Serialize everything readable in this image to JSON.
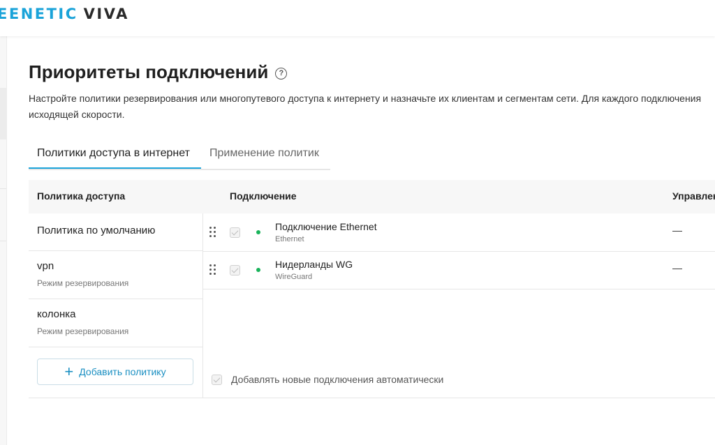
{
  "brand": {
    "part1": "EENETIC",
    "part2": "VIVA"
  },
  "page": {
    "title": "Приоритеты подключений",
    "help_icon": "question-circle-icon",
    "description_line1": "Настройте политики резервирования или многопутевого доступа к интернету и назначьте их клиентам и сегментам сети. Для каждого подключения",
    "description_line2": "исходящей скорости."
  },
  "tabs": [
    {
      "label": "Политики доступа в интернет",
      "active": true
    },
    {
      "label": "Применение политик",
      "active": false
    }
  ],
  "table": {
    "headers": {
      "policy": "Политика доступа",
      "connection": "Подключение",
      "management": "Управлен"
    },
    "policies": [
      {
        "name": "Политика по умолчанию",
        "mode": ""
      },
      {
        "name": "vpn",
        "mode": "Режим резервирования"
      },
      {
        "name": "колонка",
        "mode": "Режим резервирования"
      }
    ],
    "add_policy_label": "Добавить политику",
    "connections": [
      {
        "name": "Подключение Ethernet",
        "type": "Ethernet",
        "status": "online",
        "management": "—"
      },
      {
        "name": "Нидерланды WG",
        "type": "WireGuard",
        "status": "online",
        "management": "—"
      }
    ],
    "auto_add_label": "Добавлять новые подключения автоматически"
  },
  "colors": {
    "accent": "#1aa3d9",
    "status_online": "#19b35a"
  }
}
